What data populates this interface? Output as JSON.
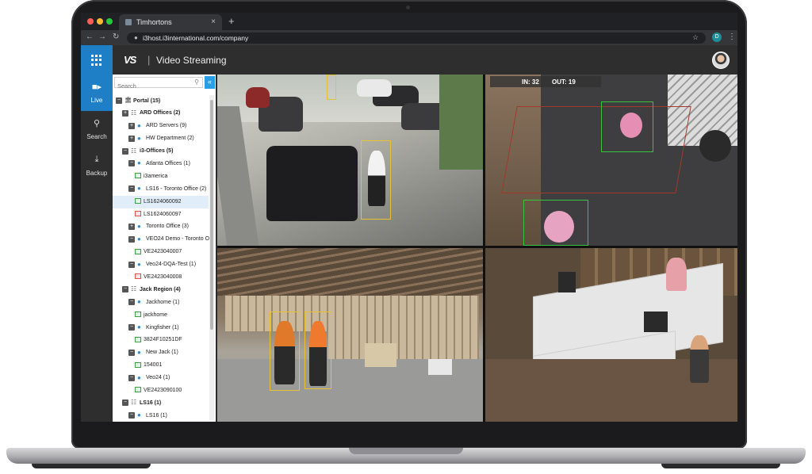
{
  "browser": {
    "tab_title": "Timhortons",
    "tab_close": "×",
    "new_tab": "+",
    "url": "i3host.i3international.com/company",
    "profile_initial": "D"
  },
  "app": {
    "logo": "VS",
    "separator": "|",
    "title": "Video Streaming",
    "accent_color": "#1e7fc7"
  },
  "rail": {
    "items": [
      {
        "label": "Live",
        "icon": "video-camera-icon"
      },
      {
        "label": "Search",
        "icon": "search-icon"
      },
      {
        "label": "Backup",
        "icon": "download-icon"
      }
    ]
  },
  "tree": {
    "search_placeholder": "Search",
    "nodes": [
      {
        "label": "Portal (15)",
        "toggle": "−",
        "type": "portal"
      },
      {
        "label": "ARD Offices (2)",
        "toggle": "+",
        "type": "group"
      },
      {
        "label": "ARD Servers (9)",
        "toggle": "+",
        "type": "location"
      },
      {
        "label": "HW Department (2)",
        "toggle": "+",
        "type": "location"
      },
      {
        "label": "i3-Offices (5)",
        "toggle": "−",
        "type": "group"
      },
      {
        "label": "Atlanta Offices (1)",
        "toggle": "−",
        "type": "location"
      },
      {
        "label": "i3america",
        "type": "camera"
      },
      {
        "label": "LS16 - Toronto Office (2)",
        "toggle": "−",
        "type": "location"
      },
      {
        "label": "LS1624060092",
        "type": "camera",
        "selected": true
      },
      {
        "label": "LS1624060097",
        "type": "camera-offline"
      },
      {
        "label": "Toronto Office (3)",
        "toggle": "+",
        "type": "location"
      },
      {
        "label": "VEO24 Demo - Toronto Off",
        "toggle": "−",
        "type": "location"
      },
      {
        "label": "VE2423040007",
        "type": "camera"
      },
      {
        "label": "Veo24-DQA-Test (1)",
        "toggle": "−",
        "type": "location"
      },
      {
        "label": "VE2423040008",
        "type": "camera-offline"
      },
      {
        "label": "Jack Region (4)",
        "toggle": "−",
        "type": "group"
      },
      {
        "label": "Jackhome (1)",
        "toggle": "−",
        "type": "location"
      },
      {
        "label": "jackhome",
        "type": "camera"
      },
      {
        "label": "Kingfisher (1)",
        "toggle": "−",
        "type": "location"
      },
      {
        "label": "3824F10251DF",
        "type": "camera"
      },
      {
        "label": "New Jack (1)",
        "toggle": "−",
        "type": "location"
      },
      {
        "label": "154001",
        "type": "camera"
      },
      {
        "label": "Veo24 (1)",
        "toggle": "−",
        "type": "location"
      },
      {
        "label": "VE2423090100",
        "type": "camera"
      },
      {
        "label": "LS16 (1)",
        "toggle": "−",
        "type": "group"
      },
      {
        "label": "LS16 (1)",
        "toggle": "−",
        "type": "location"
      }
    ]
  },
  "videos": {
    "counter_in": "IN: 32",
    "counter_out": "OUT: 19"
  }
}
